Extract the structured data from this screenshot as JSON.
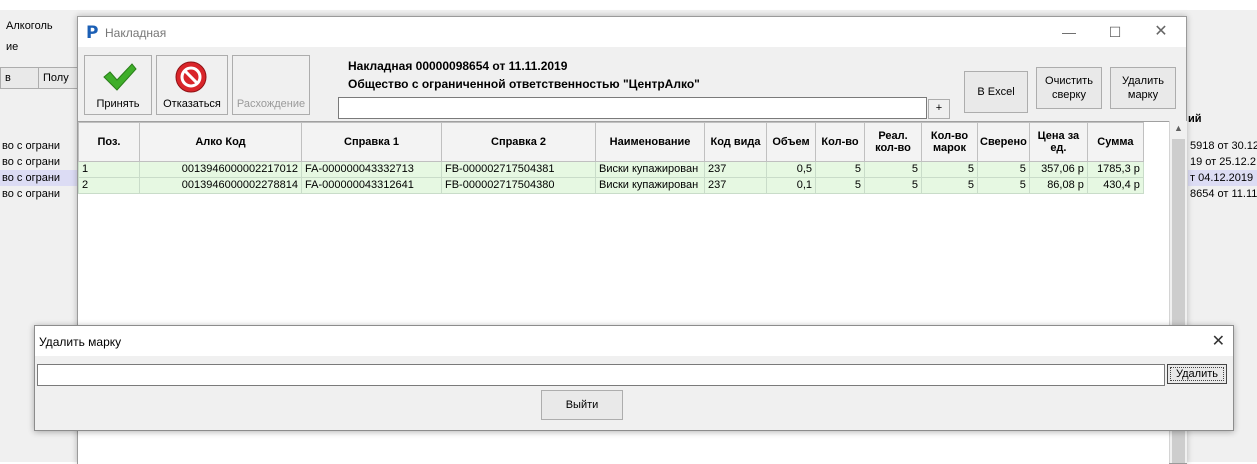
{
  "background": {
    "menu_item": "Алкоголь",
    "tab_partial": "ие",
    "btn_partial_left": "в",
    "btn_partial_right": "Полу",
    "right_header": "ий",
    "left_rows": [
      "во с ограни",
      "во с ограни",
      "во с ограни",
      "во с ограни"
    ],
    "right_rows": [
      "5918 от 30.12",
      "19 от 25.12.2",
      "т 04.12.2019",
      "8654 от 11.11"
    ]
  },
  "window": {
    "logo": "P",
    "title": "Накладная",
    "minimize": "—",
    "maximize": "☐",
    "close": "✕"
  },
  "toolbar": {
    "accept_label": "Принять",
    "reject_label": "Отказаться",
    "discrepancy_label": "Расхождение",
    "excel_label": "В Excel",
    "clear_label": "Очистить сверку",
    "delete_mark_label": "Удалить марку",
    "plus_label": "+"
  },
  "invoice": {
    "title": "Накладная 00000098654 от 11.11.2019",
    "org": "Общество с ограниченной ответственностью \"ЦентрАлко\"",
    "filter_value": ""
  },
  "grid": {
    "columns": [
      "Поз.",
      "Алко Код",
      "Справка 1",
      "Справка 2",
      "Наименование",
      "Код вида",
      "Объем",
      "Кол-во",
      "Реал. кол-во",
      "Кол-во марок",
      "Сверено",
      "Цена за ед.",
      "Сумма"
    ],
    "rows": [
      [
        "1",
        "0013946000002217012",
        "FA-000000043332713",
        "FB-000002717504381",
        "Виски купажирован",
        "237",
        "0,5",
        "5",
        "5",
        "5",
        "5",
        "357,06 р",
        "1785,3 р"
      ],
      [
        "2",
        "0013946000002278814",
        "FA-000000043312641",
        "FB-000002717504380",
        "Виски купажирован",
        "237",
        "0,1",
        "5",
        "5",
        "5",
        "5",
        "86,08 р",
        "430,4 р"
      ]
    ]
  },
  "dialog": {
    "title": "Удалить марку",
    "close": "✕",
    "input_value": "",
    "delete_label": "Удалить",
    "exit_label": "Выйти"
  },
  "colors": {
    "row_bg": "#e6f8e2",
    "accept_green": "#3fae2a",
    "reject_red": "#d9252a",
    "logo_blue": "#1b5fb5"
  }
}
